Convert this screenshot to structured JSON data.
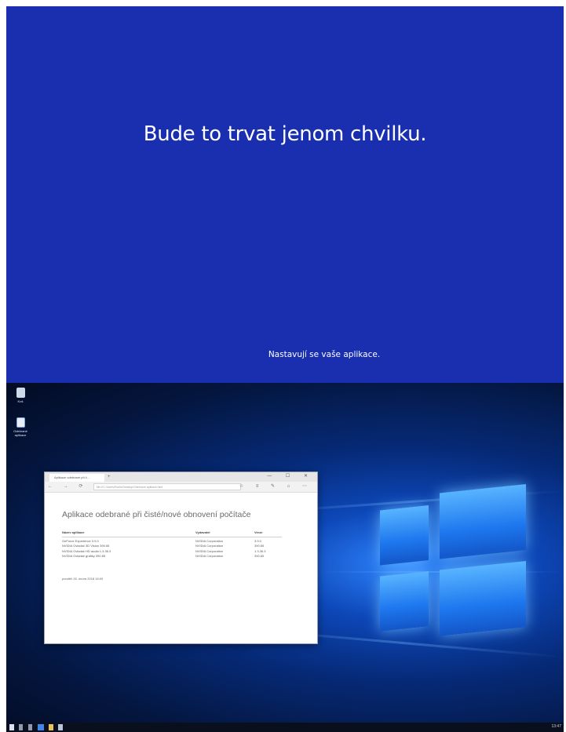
{
  "oobe": {
    "title": "Bude to trvat jenom chvilku.",
    "subtitle": "Nastavují se vaše aplikace."
  },
  "desktop": {
    "icons": [
      {
        "name": "recycle-bin-icon",
        "label": "Koš"
      },
      {
        "name": "document-icon",
        "label": "Odebrané aplikace"
      }
    ]
  },
  "browser": {
    "tab_title": "Aplikace odebrané při č…",
    "url": "file:///C:/Users/Public/Desktop/Odebrané aplikace.html",
    "page_heading": "Aplikace odebrané při čisté/nové obnovení počítače",
    "table": {
      "headers": [
        "Název aplikace",
        "Vydavatel",
        "Verze"
      ],
      "rows": [
        [
          "GeForce Experience 3.9.0",
          "NVIDIA Corporation",
          "3.9.0"
        ],
        [
          "NVIDIA Ovladač 3D Vision 390.65",
          "NVIDIA Corporation",
          "390.65"
        ],
        [
          "NVIDIA Ovladač HD audia 1.3.36.3",
          "NVIDIA Corporation",
          "1.3.36.3"
        ],
        [
          "NVIDIA Ovladač grafiky 390.65",
          "NVIDIA Corporation",
          "390.65"
        ]
      ]
    },
    "footer": "pondělí 26. února 2018 16:00"
  },
  "taskbar": {
    "clock": "13:47"
  },
  "colors": {
    "oobe_background": "#1a2fb0",
    "desktop_accent": "#1e78ef"
  }
}
